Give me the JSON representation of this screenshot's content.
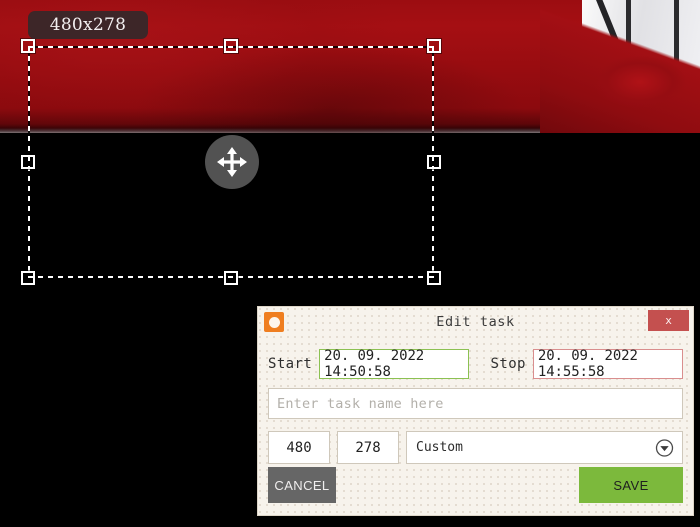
{
  "overlay": {
    "size_tooltip": "480x278",
    "move_handle_icon": "move-arrows-icon"
  },
  "dialog": {
    "title": "Edit task",
    "app_icon": "app-logo-icon",
    "close_label": "x",
    "start_label": "Start",
    "start_value": "20. 09. 2022  14:50:58",
    "stop_label": "Stop",
    "stop_value": "20. 09. 2022  14:55:58",
    "task_name_value": "",
    "task_name_placeholder": "Enter task name here",
    "width_value": "480",
    "height_value": "278",
    "preset_value": "Custom",
    "cancel_label": "CANCEL",
    "save_label": "SAVE",
    "colors": {
      "start_border": "#8cc152",
      "stop_border": "#d98e8e",
      "save_bg": "#7cb93c",
      "cancel_bg": "#666666",
      "close_bg": "#c4504f",
      "app_icon_bg": "#ef7e20",
      "dialog_bg": "#f7f3ec"
    }
  }
}
